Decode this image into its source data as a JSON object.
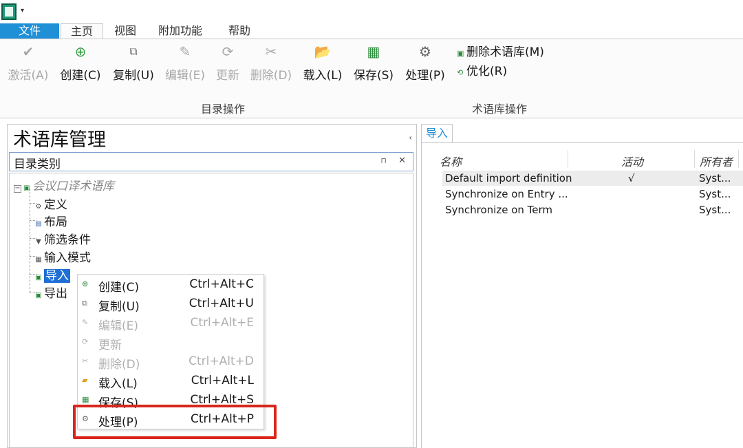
{
  "titlebar": {
    "quick_access": "▾"
  },
  "tabs": {
    "file": "文件",
    "home": "主页",
    "view": "视图",
    "addins": "附加功能",
    "help": "帮助"
  },
  "ribbon": {
    "activate": "激活(A)",
    "create": "创建(C)",
    "copy": "复制(U)",
    "edit": "编辑(E)",
    "update": "更新",
    "delete": "删除(D)",
    "load": "载入(L)",
    "save": "保存(S)",
    "process": "处理(P)",
    "delete_termbase": "删除术语库(M)",
    "optimize": "优化(R)",
    "group_catalog": "目录操作",
    "group_termbase": "术语库操作"
  },
  "left_panel": {
    "title": "术语库管理",
    "category_label": "目录类别",
    "tree": {
      "root": "会议口译术语库",
      "items": [
        "定义",
        "布局",
        "筛选条件",
        "输入模式",
        "导入",
        "导出"
      ]
    }
  },
  "context_menu": {
    "items": [
      {
        "label": "创建(C)",
        "shortcut": "Ctrl+Alt+C"
      },
      {
        "label": "复制(U)",
        "shortcut": "Ctrl+Alt+U"
      },
      {
        "label": "编辑(E)",
        "shortcut": "Ctrl+Alt+E"
      },
      {
        "label": "更新",
        "shortcut": ""
      },
      {
        "label": "删除(D)",
        "shortcut": "Ctrl+Alt+D"
      },
      {
        "label": "载入(L)",
        "shortcut": "Ctrl+Alt+L"
      },
      {
        "label": "保存(S)",
        "shortcut": "Ctrl+Alt+S"
      },
      {
        "label": "处理(P)",
        "shortcut": "Ctrl+Alt+P"
      }
    ]
  },
  "right_panel": {
    "tab": "导入",
    "columns": {
      "name": "名称",
      "active": "活动",
      "owner": "所有者"
    },
    "rows": [
      {
        "name": "Default import definition",
        "active": "√",
        "owner": "Syst..."
      },
      {
        "name": "Synchronize on Entry ...",
        "active": "",
        "owner": "Syst..."
      },
      {
        "name": "Synchronize on Term",
        "active": "",
        "owner": "Syst..."
      }
    ]
  }
}
